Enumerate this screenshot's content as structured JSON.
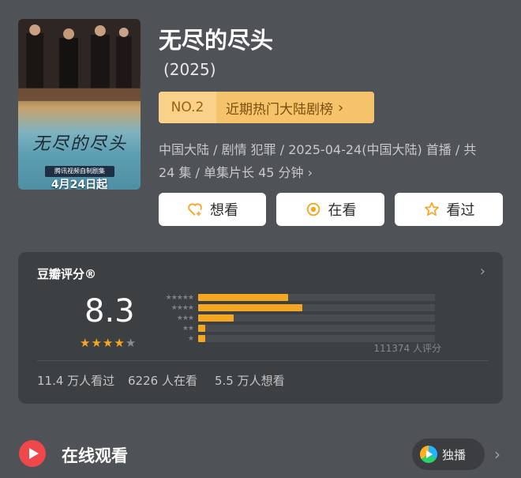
{
  "poster": {
    "title_art": "无尽的尽头",
    "badge": "腾讯视频自制剧集",
    "release_caption": "4月24日起"
  },
  "show": {
    "title": "无尽的尽头",
    "year": "(2025)"
  },
  "rank": {
    "no": "NO.2",
    "label": "近期热门大陆剧榜"
  },
  "meta": {
    "line1": "中国大陆 / 剧情 犯罪 / 2025-04-24(中国大陆) 首播 / 共",
    "line2": "24 集 / 单集片长 45 分钟"
  },
  "actions": {
    "want": "想看",
    "watching": "在看",
    "watched": "看过"
  },
  "rating": {
    "heading": "豆瓣评分®",
    "score": "8.3",
    "stars_value": 4,
    "distribution": [
      {
        "stars": "★★★★★",
        "fraction": 0.38
      },
      {
        "stars": "★★★★",
        "fraction": 0.44
      },
      {
        "stars": "★★★",
        "fraction": 0.15
      },
      {
        "stars": "★★",
        "fraction": 0.03
      },
      {
        "stars": "★",
        "fraction": 0.03
      }
    ],
    "votes": "111374 人评分"
  },
  "stats": {
    "watched": "11.4 万人看过",
    "watching": "6226 人在看",
    "want": "5.5 万人想看"
  },
  "online": {
    "label": "在线观看",
    "exclusive": "独播"
  },
  "colors": {
    "accent": "#f5a623",
    "rank_bg": "#f5c46a",
    "play_red": "#f0474b"
  }
}
